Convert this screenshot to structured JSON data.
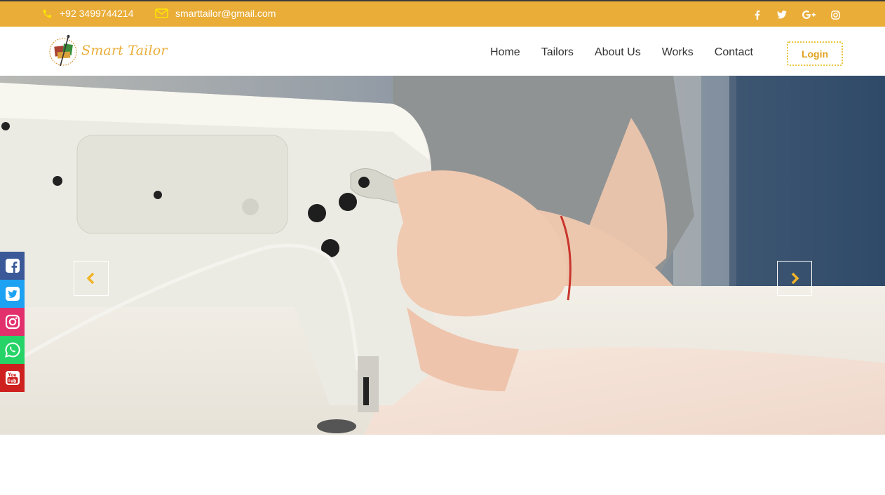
{
  "topbar": {
    "phone": "+92 3499744214",
    "email": "smarttailor@gmail.com",
    "social_icons": [
      "facebook-icon",
      "twitter-icon",
      "google-plus-icon",
      "instagram-icon"
    ]
  },
  "header": {
    "logo_text": "Smart Tailor",
    "nav": [
      {
        "label": "Home"
      },
      {
        "label": "Tailors"
      },
      {
        "label": "About Us"
      },
      {
        "label": "Works"
      },
      {
        "label": "Contact"
      }
    ],
    "login_label": "Login"
  },
  "hero": {
    "prev_icon": "chevron-left-icon",
    "next_icon": "chevron-right-icon"
  },
  "side_social": [
    "facebook-icon",
    "twitter-icon",
    "instagram-icon",
    "whatsapp-icon",
    "youtube-icon"
  ],
  "colors": {
    "brand": "#e9ad38",
    "login_border": "#e9c63b",
    "facebook": "#3b5998",
    "twitter": "#1da1f2",
    "instagram": "#e1306c",
    "whatsapp": "#25d366",
    "youtube": "#cd201f"
  }
}
